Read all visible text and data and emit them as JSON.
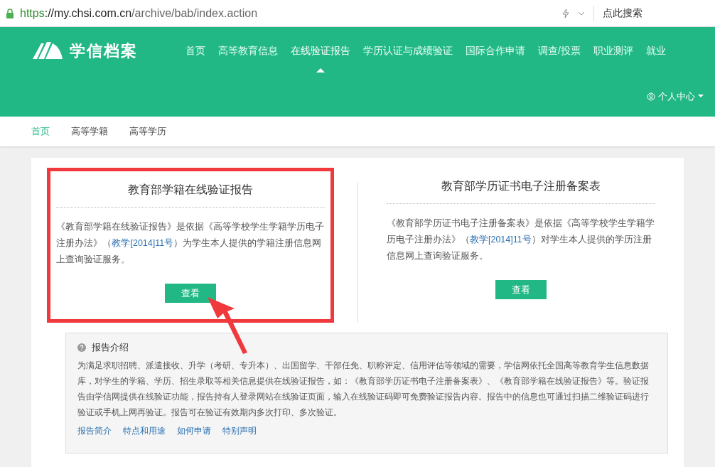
{
  "address_bar": {
    "url_scheme": "https",
    "url_host": "://my.chsi.com.cn",
    "url_path": "/archive/bab/index.action",
    "search_label": "点此搜索"
  },
  "header": {
    "logo_text": "学信档案",
    "nav": [
      {
        "label": "首页",
        "selected": false
      },
      {
        "label": "高等教育信息",
        "selected": false
      },
      {
        "label": "在线验证报告",
        "selected": true
      },
      {
        "label": "学历认证与成绩验证",
        "selected": false
      },
      {
        "label": "国际合作申请",
        "selected": false
      },
      {
        "label": "调查/投票",
        "selected": false
      },
      {
        "label": "职业测评",
        "selected": false
      },
      {
        "label": "就业",
        "selected": false
      }
    ],
    "user_menu": "个人中心"
  },
  "subnav": [
    {
      "label": "首页",
      "selected": true
    },
    {
      "label": "高等学籍",
      "selected": false
    },
    {
      "label": "高等学历",
      "selected": false
    }
  ],
  "cards": [
    {
      "title": "教育部学籍在线验证报告",
      "text_before": "《教育部学籍在线验证报告》是依据《高等学校学生学籍学历电子注册办法》（",
      "link": "教学[2014]11号",
      "text_after": "）为学生本人提供的学籍注册信息网上查询验证服务。",
      "button": "查看",
      "highlighted": true
    },
    {
      "title": "教育部学历证书电子注册备案表",
      "text_before": "《教育部学历证书电子注册备案表》是依据《高等学校学生学籍学历电子注册办法》（",
      "link": "教学[2014]11号",
      "text_after": "）对学生本人提供的学历注册信息网上查询验证服务。",
      "button": "查看",
      "highlighted": false
    }
  ],
  "intro": {
    "title": "报告介绍",
    "text": "为满足求职招聘、派遣接收、升学（考研、专升本）、出国留学、干部任免、职称评定、信用评估等领域的需要，学信网依托全国高等教育学生信息数据库，对学生的学籍、学历、招生录取等相关信息提供在线验证报告，如：《教育部学历证书电子注册备案表》、《教育部学籍在线验证报告》等。验证报告由学信网提供在线验证功能，报告持有人登录网站在线验证页面，输入在线验证码即可免费验证报告内容。报告中的信息也可通过扫描二维验证码进行验证或手机上网再验证。报告可在验证有效期内多次打印、多次验证。",
    "links": [
      "报告简介",
      "特点和用途",
      "如何申请",
      "特别声明"
    ]
  }
}
